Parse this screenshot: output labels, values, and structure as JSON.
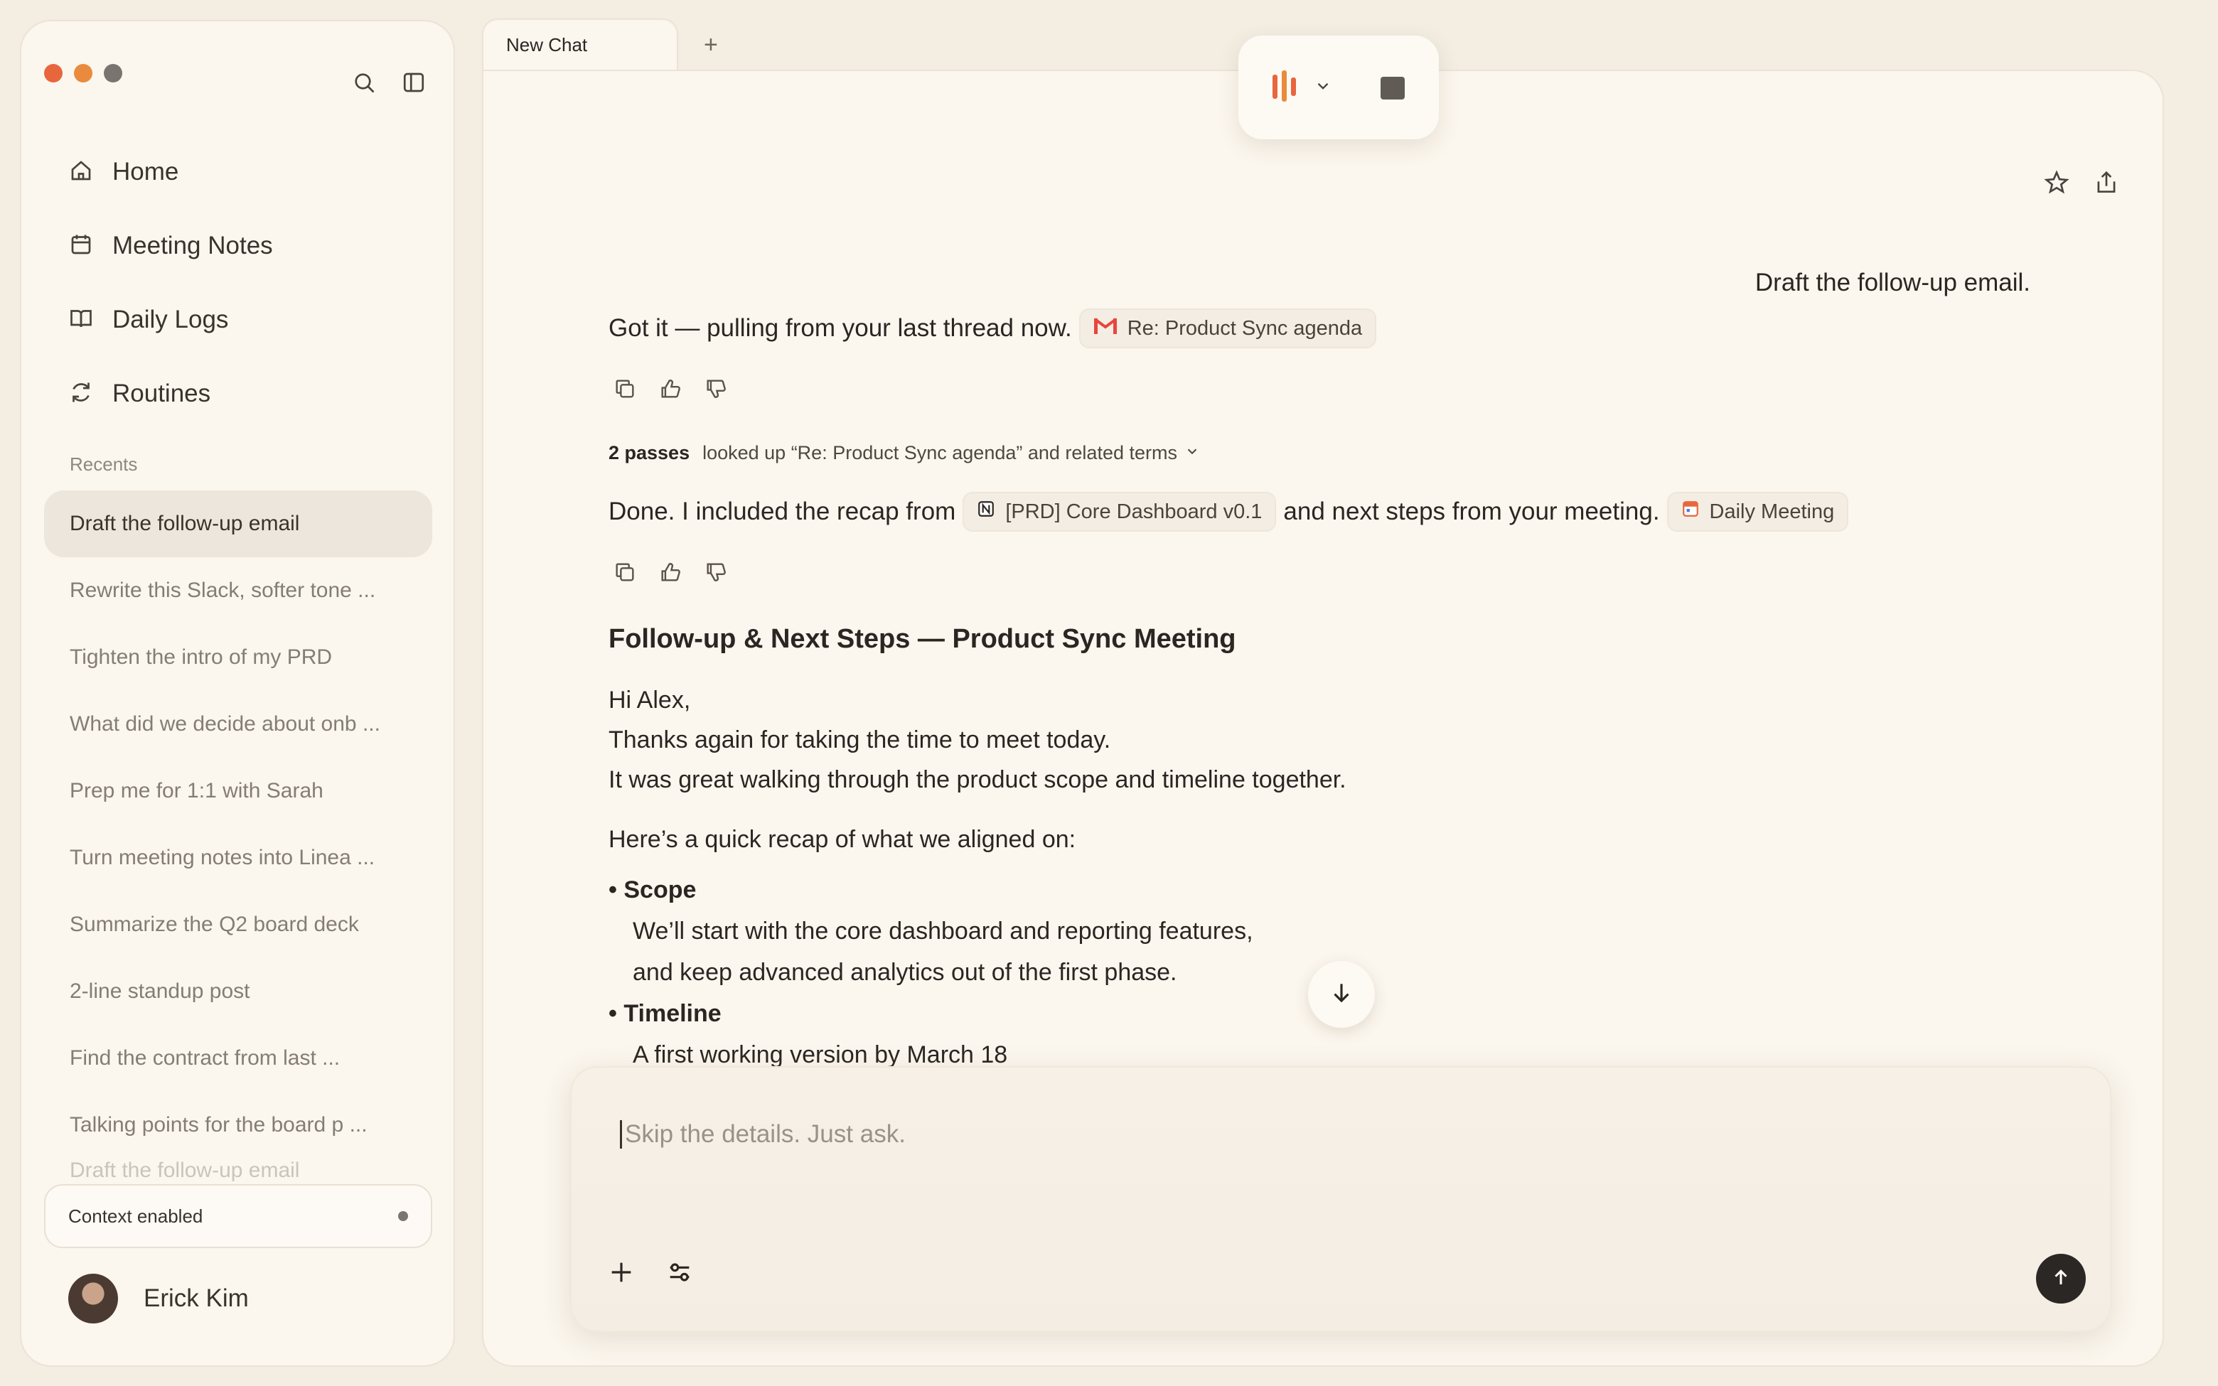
{
  "sidebar": {
    "nav": [
      {
        "label": "Home",
        "icon": "home-icon"
      },
      {
        "label": "Meeting Notes",
        "icon": "calendar-icon"
      },
      {
        "label": "Daily Logs",
        "icon": "book-icon"
      },
      {
        "label": "Routines",
        "icon": "refresh-icon"
      }
    ],
    "recents_title": "Recents",
    "recents": [
      "Draft the follow-up email",
      "Rewrite this Slack, softer tone ...",
      "Tighten the intro of my PRD",
      "What did we decide about onb ...",
      "Prep me for 1:1 with Sarah",
      "Turn meeting notes into Linea ...",
      "Summarize the Q2 board deck",
      "2-line standup post",
      "Find the contract from last ...",
      "Talking points for the board p ...",
      "Draft the follow-up email"
    ],
    "context_label": "Context enabled",
    "user_name": "Erick Kim"
  },
  "tabs": {
    "active_label": "New Chat",
    "add_label": "+"
  },
  "chat": {
    "user_message": "Draft the follow-up email.",
    "reply1_text": "Got it — pulling from your last thread now.",
    "reply1_chip": "Re: Product Sync agenda",
    "passes_count": "2 passes",
    "passes_text": "looked up “Re: Product Sync agenda” and related terms",
    "reply2_text_a": "Done. I included the recap from",
    "reply2_chip_a": "[PRD] Core Dashboard v0.1",
    "reply2_text_b": "and next steps from your meeting.",
    "reply2_chip_b": "Daily Meeting"
  },
  "document": {
    "title": "Follow-up & Next Steps — Product Sync Meeting",
    "greeting": "Hi Alex,",
    "line1": "Thanks again for taking the time to meet today.",
    "line2": "It was great walking through the product scope and timeline together.",
    "recap_intro": "Here’s a quick recap of what we aligned on:",
    "bullets": [
      {
        "title": "Scope",
        "lines": [
          "We’ll start with the core dashboard and reporting features,",
          "and keep advanced analytics out of the first phase."
        ]
      },
      {
        "title": "Timeline",
        "lines": [
          "A first working version by March 18"
        ]
      }
    ]
  },
  "composer": {
    "placeholder": "Skip the details. Just ask."
  },
  "colors": {
    "accent": "#e8663d",
    "background": "#fbf6ee",
    "sidebar_active": "#ede6dc"
  }
}
